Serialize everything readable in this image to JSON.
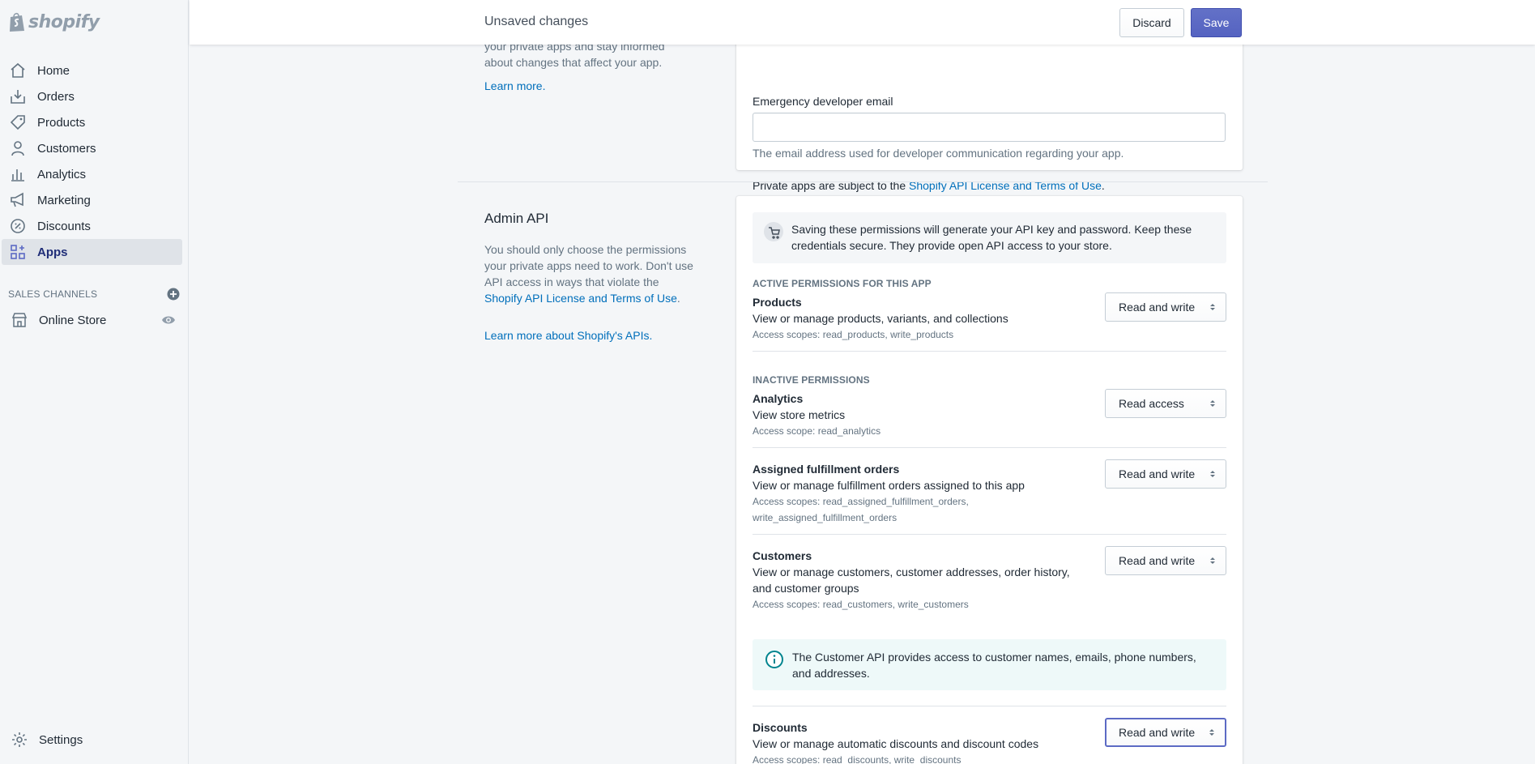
{
  "brand": {
    "name": "shopify"
  },
  "nav": {
    "items": [
      {
        "label": "Home",
        "icon": "home-icon"
      },
      {
        "label": "Orders",
        "icon": "orders-icon"
      },
      {
        "label": "Products",
        "icon": "tag-icon"
      },
      {
        "label": "Customers",
        "icon": "person-icon"
      },
      {
        "label": "Analytics",
        "icon": "bar-chart-icon"
      },
      {
        "label": "Marketing",
        "icon": "megaphone-icon"
      },
      {
        "label": "Discounts",
        "icon": "discount-icon"
      },
      {
        "label": "Apps",
        "icon": "apps-icon",
        "active": true
      }
    ],
    "sales_channels_title": "SALES CHANNELS",
    "online_store": "Online Store",
    "settings": "Settings"
  },
  "topbar": {
    "title": "Unsaved changes",
    "discard": "Discard",
    "save": "Save"
  },
  "contact_section": {
    "desc": "your private apps and stay informed about changes that affect your app.",
    "learn_more": "Learn more.",
    "field_label": "Emergency developer email",
    "field_value": "",
    "help": "The email address used for developer communication regarding your app.",
    "terms_prefix": "Private apps are subject to the ",
    "terms_link": "Shopify API License and Terms of Use",
    "terms_suffix": "."
  },
  "admin_api": {
    "title": "Admin API",
    "desc_text": "You should only choose the permissions your private apps need to work. Don't use API access in ways that violate the ",
    "desc_link": "Shopify API License and Terms of Use",
    "desc_suffix": ".",
    "learn_more": "Learn more about Shopify's APIs.",
    "banner": "Saving these permissions will generate your API key and password. Keep these credentials secure. They provide open API access to your store.",
    "active_heading": "ACTIVE PERMISSIONS FOR THIS APP",
    "inactive_heading": "INACTIVE PERMISSIONS",
    "permissions": [
      {
        "title": "Products",
        "desc": "View or manage products, variants, and collections",
        "scope": "Access scopes: read_products, write_products",
        "value": "Read and write"
      },
      {
        "title": "Analytics",
        "desc": "View store metrics",
        "scope": "Access scope: read_analytics",
        "value": "Read access"
      },
      {
        "title": "Assigned fulfillment orders",
        "desc": "View or manage fulfillment orders assigned to this app",
        "scope": "Access scopes: read_assigned_fulfillment_orders, write_assigned_fulfillment_orders",
        "value": "Read and write"
      },
      {
        "title": "Customers",
        "desc": "View or manage customers, customer addresses, order history, and customer groups",
        "scope": "Access scopes: read_customers, write_customers",
        "value": "Read and write"
      },
      {
        "title": "Discounts",
        "desc": "View or manage automatic discounts and discount codes",
        "scope": "Access scopes: read_discounts, write_discounts",
        "value": "Read and write"
      }
    ],
    "customer_notice": "The Customer API provides access to customer names, emails, phone numbers, and addresses."
  },
  "colors": {
    "accent": "#5c6ac4",
    "link": "#006fbb",
    "active_nav": "#202e78"
  }
}
